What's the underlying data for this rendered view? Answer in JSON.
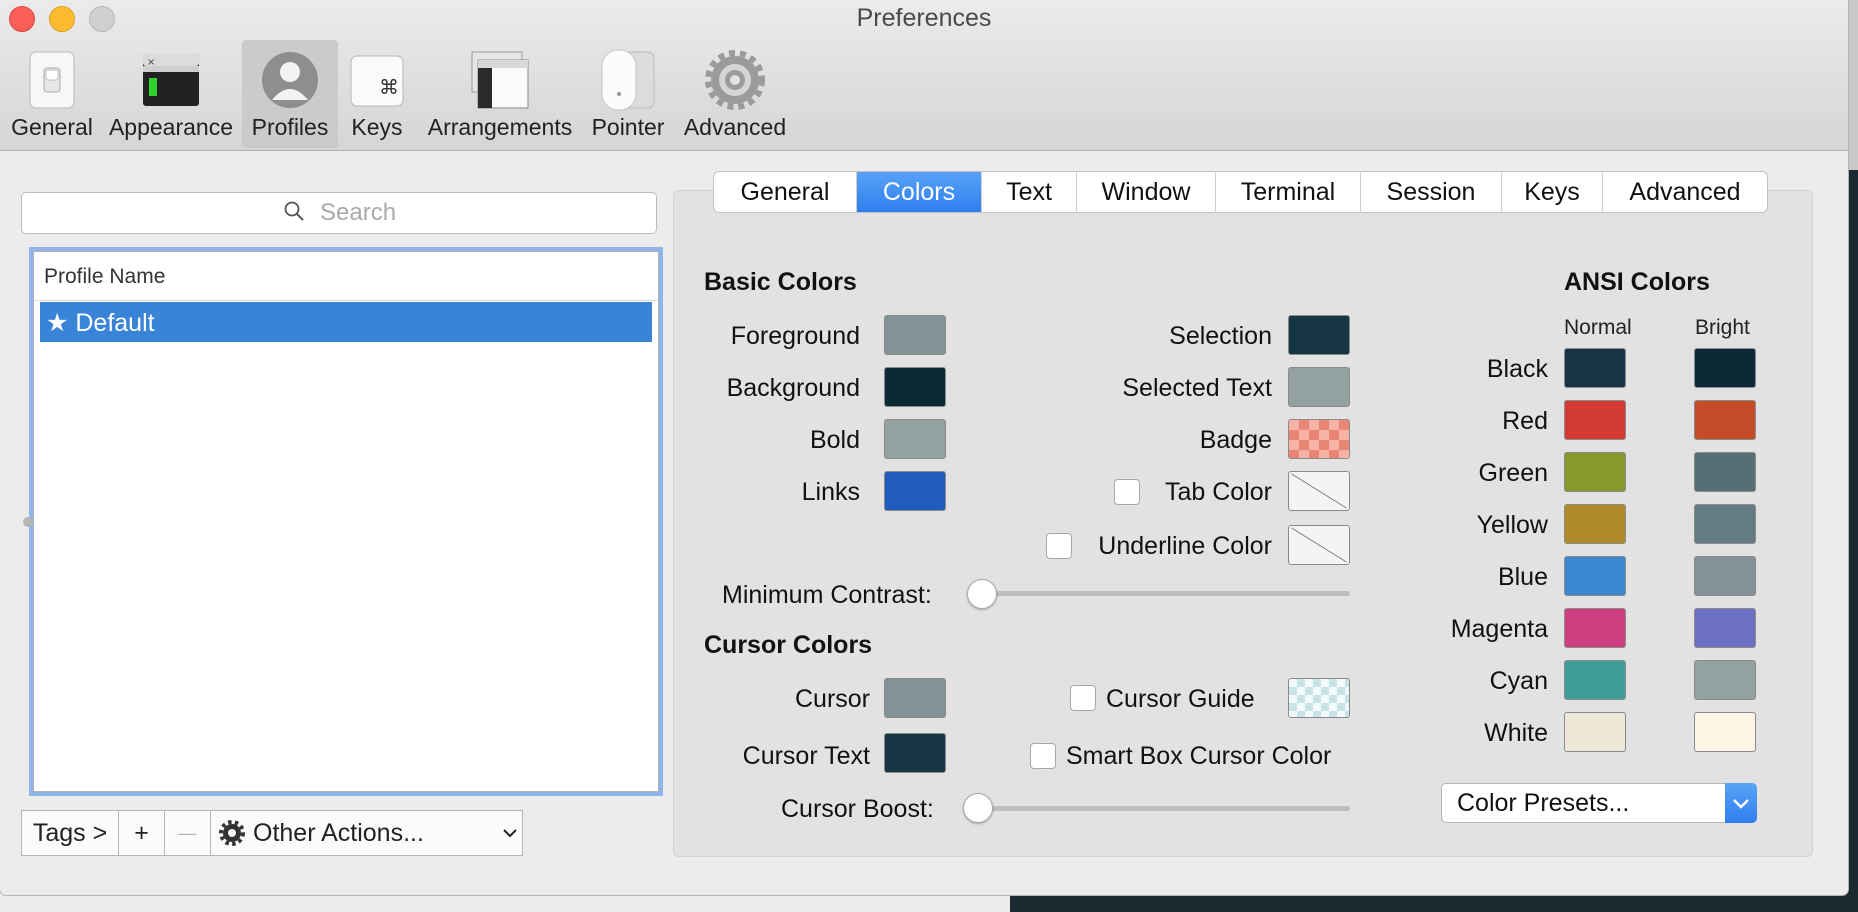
{
  "window": {
    "title": "Preferences"
  },
  "toolbar": {
    "items": [
      {
        "label": "General",
        "icon": "general-switch-icon"
      },
      {
        "label": "Appearance",
        "icon": "appearance-terminal-icon"
      },
      {
        "label": "Profiles",
        "icon": "profiles-person-icon",
        "selected": true
      },
      {
        "label": "Keys",
        "icon": "keys-command-icon"
      },
      {
        "label": "Arrangements",
        "icon": "arrangements-windows-icon"
      },
      {
        "label": "Pointer",
        "icon": "pointer-mouse-icon"
      },
      {
        "label": "Advanced",
        "icon": "advanced-gear-icon"
      }
    ]
  },
  "sidebar": {
    "search_placeholder": "Search",
    "column_header": "Profile Name",
    "profiles": [
      {
        "name": "★ Default",
        "selected": true
      }
    ],
    "buttons": {
      "tags": "Tags >",
      "add": "+",
      "remove": "—",
      "other_actions": "Other Actions..."
    }
  },
  "tabs": [
    {
      "label": "General"
    },
    {
      "label": "Colors",
      "active": true
    },
    {
      "label": "Text"
    },
    {
      "label": "Window"
    },
    {
      "label": "Terminal"
    },
    {
      "label": "Session"
    },
    {
      "label": "Keys"
    },
    {
      "label": "Advanced"
    }
  ],
  "basic_colors": {
    "title": "Basic Colors",
    "left": [
      {
        "label": "Foreground",
        "color": "#839496"
      },
      {
        "label": "Background",
        "color": "#0b2a35"
      },
      {
        "label": "Bold",
        "color": "#93a1a1"
      },
      {
        "label": "Links",
        "color": "#1f5cbd"
      }
    ],
    "right": [
      {
        "label": "Selection",
        "color": "#163542",
        "checkbox": false
      },
      {
        "label": "Selected Text",
        "color": "#93a1a1",
        "checkbox": false
      },
      {
        "label": "Badge",
        "color": "#f2a18e",
        "checkbox": false,
        "pattern": "checker"
      },
      {
        "label": "Tab Color",
        "color": "none",
        "checkbox": true,
        "checked": false
      },
      {
        "label": "Underline Color",
        "color": "none",
        "checkbox": true,
        "checked": false
      }
    ],
    "minimum_contrast_label": "Minimum Contrast:",
    "minimum_contrast_value": 0
  },
  "cursor_colors": {
    "title": "Cursor Colors",
    "cursor_label": "Cursor",
    "cursor_color": "#839496",
    "cursor_text_label": "Cursor Text",
    "cursor_text_color": "#163542",
    "cursor_guide_label": "Cursor Guide",
    "cursor_guide_checked": false,
    "cursor_guide_color": "#d9eef2",
    "smart_box_label": "Smart Box Cursor Color",
    "smart_box_checked": false,
    "cursor_boost_label": "Cursor Boost:",
    "cursor_boost_value": 0
  },
  "ansi_colors": {
    "title": "ANSI Colors",
    "normal_header": "Normal",
    "bright_header": "Bright",
    "rows": [
      {
        "name": "Black",
        "normal": "#163542",
        "bright": "#0b2a35"
      },
      {
        "name": "Red",
        "normal": "#d33a34",
        "bright": "#c54c28"
      },
      {
        "name": "Green",
        "normal": "#879a2c",
        "bright": "#586e75"
      },
      {
        "name": "Yellow",
        "normal": "#ae8a2a",
        "bright": "#657b83"
      },
      {
        "name": "Blue",
        "normal": "#3a86d1",
        "bright": "#839496"
      },
      {
        "name": "Magenta",
        "normal": "#cd3f80",
        "bright": "#6b70c2"
      },
      {
        "name": "Cyan",
        "normal": "#3f9e96",
        "bright": "#93a1a1"
      },
      {
        "name": "White",
        "normal": "#ede7d6",
        "bright": "#fdf6e4"
      }
    ],
    "presets_label": "Color Presets..."
  }
}
